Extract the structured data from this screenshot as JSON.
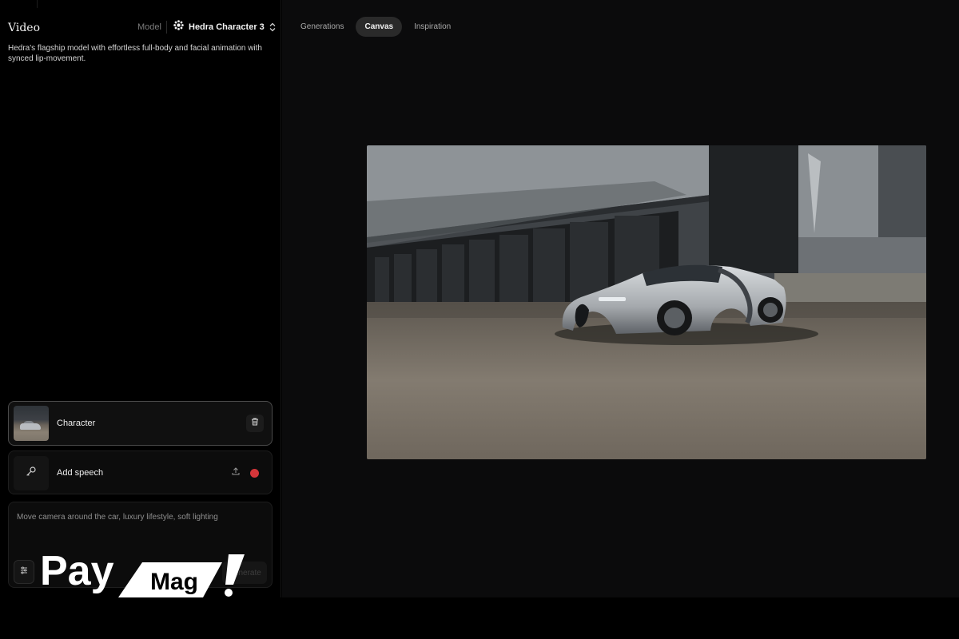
{
  "sidebar": {
    "title": "Video",
    "model_label": "Model",
    "model_name": "Hedra Character 3",
    "description": "Hedra's flagship model with effortless full-body and facial animation with synced lip-movement.",
    "character_card": {
      "label": "Character",
      "delete_icon": "trash-icon"
    },
    "speech_card": {
      "label": "Add speech",
      "mic_icon": "microphone-icon",
      "upload_icon": "upload-icon",
      "record_color": "#d4363a"
    },
    "prompt": {
      "text": "Move camera around the car, luxury lifestyle, soft lighting",
      "settings_icon": "sliders-icon",
      "generate_label": "Generate"
    }
  },
  "main": {
    "tabs": [
      {
        "label": "Generations",
        "active": false
      },
      {
        "label": "Canvas",
        "active": true
      },
      {
        "label": "Inspiration",
        "active": false
      }
    ]
  },
  "watermark": {
    "brand": "PayMag!"
  }
}
